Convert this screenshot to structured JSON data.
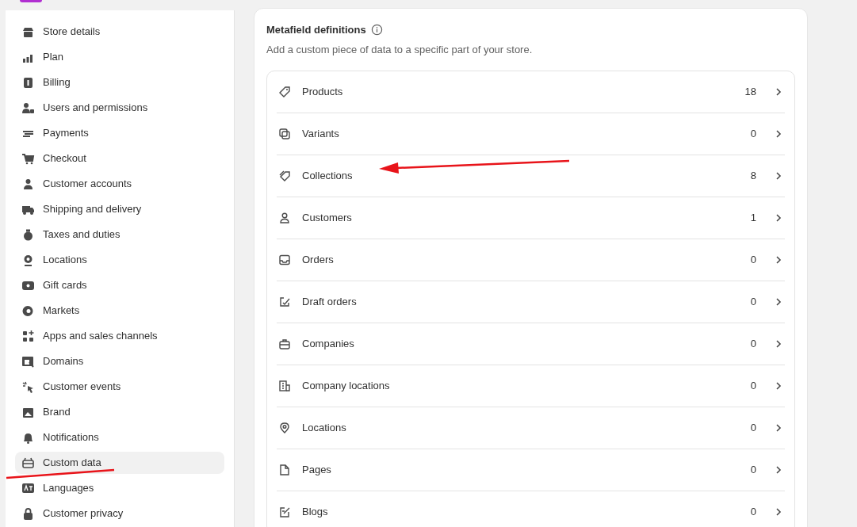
{
  "sidebar": {
    "items": [
      {
        "label": "Store details",
        "selected": false
      },
      {
        "label": "Plan",
        "selected": false
      },
      {
        "label": "Billing",
        "selected": false
      },
      {
        "label": "Users and permissions",
        "selected": false
      },
      {
        "label": "Payments",
        "selected": false
      },
      {
        "label": "Checkout",
        "selected": false
      },
      {
        "label": "Customer accounts",
        "selected": false
      },
      {
        "label": "Shipping and delivery",
        "selected": false
      },
      {
        "label": "Taxes and duties",
        "selected": false
      },
      {
        "label": "Locations",
        "selected": false
      },
      {
        "label": "Gift cards",
        "selected": false
      },
      {
        "label": "Markets",
        "selected": false
      },
      {
        "label": "Apps and sales channels",
        "selected": false
      },
      {
        "label": "Domains",
        "selected": false
      },
      {
        "label": "Customer events",
        "selected": false
      },
      {
        "label": "Brand",
        "selected": false
      },
      {
        "label": "Notifications",
        "selected": false
      },
      {
        "label": "Custom data",
        "selected": true
      },
      {
        "label": "Languages",
        "selected": false
      },
      {
        "label": "Customer privacy",
        "selected": false
      }
    ]
  },
  "metafield_definitions": {
    "title": "Metafield definitions",
    "description": "Add a custom piece of data to a specific part of your store.",
    "rows": [
      {
        "label": "Products",
        "count": "18"
      },
      {
        "label": "Variants",
        "count": "0"
      },
      {
        "label": "Collections",
        "count": "8"
      },
      {
        "label": "Customers",
        "count": "1"
      },
      {
        "label": "Orders",
        "count": "0"
      },
      {
        "label": "Draft orders",
        "count": "0"
      },
      {
        "label": "Companies",
        "count": "0"
      },
      {
        "label": "Company locations",
        "count": "0"
      },
      {
        "label": "Locations",
        "count": "0"
      },
      {
        "label": "Pages",
        "count": "0"
      },
      {
        "label": "Blogs",
        "count": "0"
      }
    ]
  }
}
